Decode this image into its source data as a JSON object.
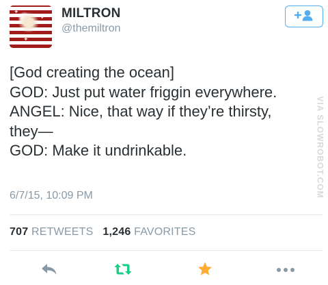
{
  "author": {
    "name": "MILTRON",
    "handle": "@themiltron"
  },
  "tweet": {
    "lines": [
      "[God creating the ocean]",
      "GOD: Just put water friggin everywhere.",
      "ANGEL: Nice, that way if they’re thirsty,",
      "they—",
      "GOD: Make it undrinkable."
    ],
    "timestamp": "6/7/15, 10:09 PM"
  },
  "stats": {
    "retweets_count": "707",
    "retweets_label": "RETWEETS",
    "favorites_count": "1,246",
    "favorites_label": "FAVORITES"
  },
  "watermark": "VIA SLOWROBOT.COM",
  "colors": {
    "twitter_blue": "#55acee",
    "retweet_green": "#19cf86",
    "favorite_gold": "#ffac33",
    "muted_gray": "#8899a6"
  },
  "icons": {
    "follow": "follow-add-user-icon",
    "reply": "reply-icon",
    "retweet": "retweet-icon",
    "favorite": "star-icon",
    "more": "more-dots-icon"
  }
}
